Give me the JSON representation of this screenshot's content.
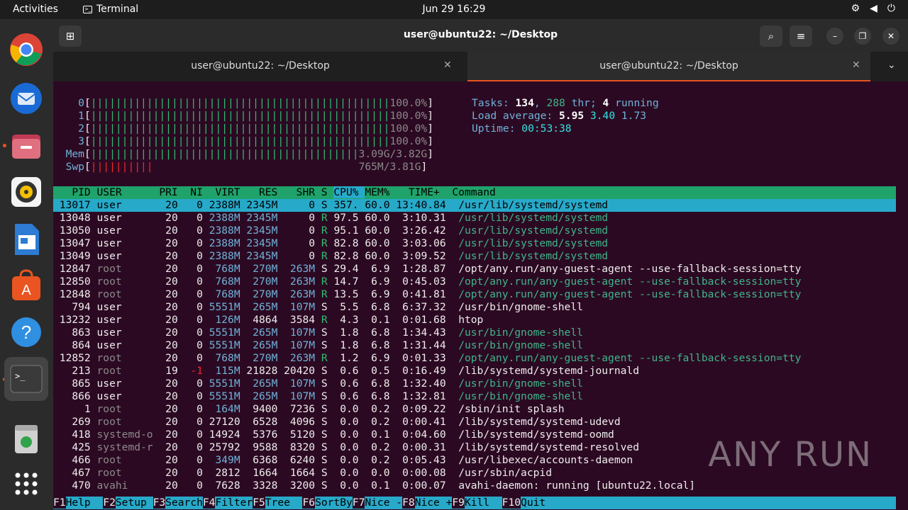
{
  "topbar": {
    "activities": "Activities",
    "app": "Terminal",
    "clock": "Jun 29  16:29"
  },
  "window": {
    "title": "user@ubuntu22: ~/Desktop"
  },
  "tabs": [
    {
      "label": "user@ubuntu22: ~/Desktop"
    },
    {
      "label": "user@ubuntu22: ~/Desktop"
    }
  ],
  "meters": {
    "cpus": [
      {
        "id": "0",
        "bar": "||||||||||||||||||||||||||||||||||||||||||||||||",
        "pct": "100.0%"
      },
      {
        "id": "1",
        "bar": "||||||||||||||||||||||||||||||||||||||||||||||||",
        "pct": "100.0%"
      },
      {
        "id": "2",
        "bar": "||||||||||||||||||||||||||||||||||||||||||||||||",
        "pct": "100.0%"
      },
      {
        "id": "3",
        "bar": "||||||||||||||||||||||||||||||||||||||||||||||||",
        "pct": "100.0%"
      }
    ],
    "mem": {
      "label": "Mem",
      "bar": "|||||||||||||||||||||||||||||||||||||||||||",
      "value": "3.09G/3.82G"
    },
    "swp": {
      "label": "Swp",
      "bar": "||||||||||",
      "value": "765M/3.81G"
    }
  },
  "summary": {
    "tasks_label": "Tasks: ",
    "tasks": "134",
    "thr_sep": ", ",
    "thr": "288",
    "thr_label": " thr; ",
    "running": "4",
    "running_label": " running",
    "load_label": "Load average: ",
    "load1": "5.95",
    "load5": "3.40",
    "load15": "1.73",
    "uptime_label": "Uptime: ",
    "uptime": "00:53:38"
  },
  "table_header": [
    "PID",
    "USER",
    "PRI",
    "NI",
    "VIRT",
    "RES",
    "SHR",
    "S",
    "CPU%",
    "MEM%",
    "TIME+",
    "Command"
  ],
  "processes": [
    {
      "pid": "13017",
      "user": "user",
      "pri": "20",
      "ni": "0",
      "virt": "2388M",
      "res": "2345M",
      "shr": "0",
      "s": "S",
      "cpu": "357.",
      "mem": "60.0",
      "time": "13:40.84",
      "cmd": "/usr/lib/systemd/systemd"
    },
    {
      "pid": "13048",
      "user": "user",
      "pri": "20",
      "ni": "0",
      "virt": "2388M",
      "res": "2345M",
      "shr": "0",
      "s": "R",
      "cpu": "97.5",
      "mem": "60.0",
      "time": "3:10.31",
      "cmd": "/usr/lib/systemd/systemd"
    },
    {
      "pid": "13050",
      "user": "user",
      "pri": "20",
      "ni": "0",
      "virt": "2388M",
      "res": "2345M",
      "shr": "0",
      "s": "R",
      "cpu": "95.1",
      "mem": "60.0",
      "time": "3:26.42",
      "cmd": "/usr/lib/systemd/systemd"
    },
    {
      "pid": "13047",
      "user": "user",
      "pri": "20",
      "ni": "0",
      "virt": "2388M",
      "res": "2345M",
      "shr": "0",
      "s": "R",
      "cpu": "82.8",
      "mem": "60.0",
      "time": "3:03.06",
      "cmd": "/usr/lib/systemd/systemd"
    },
    {
      "pid": "13049",
      "user": "user",
      "pri": "20",
      "ni": "0",
      "virt": "2388M",
      "res": "2345M",
      "shr": "0",
      "s": "R",
      "cpu": "82.8",
      "mem": "60.0",
      "time": "3:09.52",
      "cmd": "/usr/lib/systemd/systemd"
    },
    {
      "pid": "12847",
      "user": "root",
      "pri": "20",
      "ni": "0",
      "virt": "768M",
      "res": "270M",
      "shr": "263M",
      "s": "S",
      "cpu": "29.4",
      "mem": "6.9",
      "time": "1:28.87",
      "cmd": "/opt/any.run/any-guest-agent --use-fallback-session=tty"
    },
    {
      "pid": "12850",
      "user": "root",
      "pri": "20",
      "ni": "0",
      "virt": "768M",
      "res": "270M",
      "shr": "263M",
      "s": "R",
      "cpu": "14.7",
      "mem": "6.9",
      "time": "0:45.03",
      "cmd": "/opt/any.run/any-guest-agent --use-fallback-session=tty"
    },
    {
      "pid": "12848",
      "user": "root",
      "pri": "20",
      "ni": "0",
      "virt": "768M",
      "res": "270M",
      "shr": "263M",
      "s": "R",
      "cpu": "13.5",
      "mem": "6.9",
      "time": "0:41.81",
      "cmd": "/opt/any.run/any-guest-agent --use-fallback-session=tty"
    },
    {
      "pid": "794",
      "user": "user",
      "pri": "20",
      "ni": "0",
      "virt": "5551M",
      "res": "265M",
      "shr": "107M",
      "s": "S",
      "cpu": "5.5",
      "mem": "6.8",
      "time": "6:37.32",
      "cmd": "/usr/bin/gnome-shell"
    },
    {
      "pid": "13232",
      "user": "user",
      "pri": "20",
      "ni": "0",
      "virt": "126M",
      "res": "4864",
      "shr": "3584",
      "s": "R",
      "cpu": "4.3",
      "mem": "0.1",
      "time": "0:01.68",
      "cmd": "htop"
    },
    {
      "pid": "863",
      "user": "user",
      "pri": "20",
      "ni": "0",
      "virt": "5551M",
      "res": "265M",
      "shr": "107M",
      "s": "S",
      "cpu": "1.8",
      "mem": "6.8",
      "time": "1:34.43",
      "cmd": "/usr/bin/gnome-shell"
    },
    {
      "pid": "864",
      "user": "user",
      "pri": "20",
      "ni": "0",
      "virt": "5551M",
      "res": "265M",
      "shr": "107M",
      "s": "S",
      "cpu": "1.8",
      "mem": "6.8",
      "time": "1:31.44",
      "cmd": "/usr/bin/gnome-shell"
    },
    {
      "pid": "12852",
      "user": "root",
      "pri": "20",
      "ni": "0",
      "virt": "768M",
      "res": "270M",
      "shr": "263M",
      "s": "R",
      "cpu": "1.2",
      "mem": "6.9",
      "time": "0:01.33",
      "cmd": "/opt/any.run/any-guest-agent --use-fallback-session=tty"
    },
    {
      "pid": "213",
      "user": "root",
      "pri": "19",
      "ni": "-1",
      "virt": "115M",
      "res": "21828",
      "shr": "20420",
      "s": "S",
      "cpu": "0.6",
      "mem": "0.5",
      "time": "0:16.49",
      "cmd": "/lib/systemd/systemd-journald"
    },
    {
      "pid": "865",
      "user": "user",
      "pri": "20",
      "ni": "0",
      "virt": "5551M",
      "res": "265M",
      "shr": "107M",
      "s": "S",
      "cpu": "0.6",
      "mem": "6.8",
      "time": "1:32.40",
      "cmd": "/usr/bin/gnome-shell"
    },
    {
      "pid": "866",
      "user": "user",
      "pri": "20",
      "ni": "0",
      "virt": "5551M",
      "res": "265M",
      "shr": "107M",
      "s": "S",
      "cpu": "0.6",
      "mem": "6.8",
      "time": "1:32.81",
      "cmd": "/usr/bin/gnome-shell"
    },
    {
      "pid": "1",
      "user": "root",
      "pri": "20",
      "ni": "0",
      "virt": "164M",
      "res": "9400",
      "shr": "7236",
      "s": "S",
      "cpu": "0.0",
      "mem": "0.2",
      "time": "0:09.22",
      "cmd": "/sbin/init splash"
    },
    {
      "pid": "269",
      "user": "root",
      "pri": "20",
      "ni": "0",
      "virt": "27120",
      "res": "6528",
      "shr": "4096",
      "s": "S",
      "cpu": "0.0",
      "mem": "0.2",
      "time": "0:00.41",
      "cmd": "/lib/systemd/systemd-udevd"
    },
    {
      "pid": "418",
      "user": "systemd-o",
      "pri": "20",
      "ni": "0",
      "virt": "14924",
      "res": "5376",
      "shr": "5120",
      "s": "S",
      "cpu": "0.0",
      "mem": "0.1",
      "time": "0:04.60",
      "cmd": "/lib/systemd/systemd-oomd"
    },
    {
      "pid": "425",
      "user": "systemd-r",
      "pri": "20",
      "ni": "0",
      "virt": "25792",
      "res": "9588",
      "shr": "8320",
      "s": "S",
      "cpu": "0.0",
      "mem": "0.2",
      "time": "0:00.31",
      "cmd": "/lib/systemd/systemd-resolved"
    },
    {
      "pid": "466",
      "user": "root",
      "pri": "20",
      "ni": "0",
      "virt": "349M",
      "res": "6368",
      "shr": "6240",
      "s": "S",
      "cpu": "0.0",
      "mem": "0.2",
      "time": "0:05.43",
      "cmd": "/usr/libexec/accounts-daemon"
    },
    {
      "pid": "467",
      "user": "root",
      "pri": "20",
      "ni": "0",
      "virt": "2812",
      "res": "1664",
      "shr": "1664",
      "s": "S",
      "cpu": "0.0",
      "mem": "0.0",
      "time": "0:00.08",
      "cmd": "/usr/sbin/acpid"
    },
    {
      "pid": "470",
      "user": "avahi",
      "pri": "20",
      "ni": "0",
      "virt": "7628",
      "res": "3328",
      "shr": "3200",
      "s": "S",
      "cpu": "0.0",
      "mem": "0.1",
      "time": "0:00.07",
      "cmd": "avahi-daemon: running [ubuntu22.local]"
    }
  ],
  "fkeys": [
    {
      "key": "F1",
      "label": "Help  "
    },
    {
      "key": "F2",
      "label": "Setup "
    },
    {
      "key": "F3",
      "label": "Search"
    },
    {
      "key": "F4",
      "label": "Filter"
    },
    {
      "key": "F5",
      "label": "Tree  "
    },
    {
      "key": "F6",
      "label": "SortBy"
    },
    {
      "key": "F7",
      "label": "Nice -"
    },
    {
      "key": "F8",
      "label": "Nice +"
    },
    {
      "key": "F9",
      "label": "Kill  "
    },
    {
      "key": "F10",
      "label": "Quit  "
    }
  ],
  "watermark": "ANY RUN"
}
